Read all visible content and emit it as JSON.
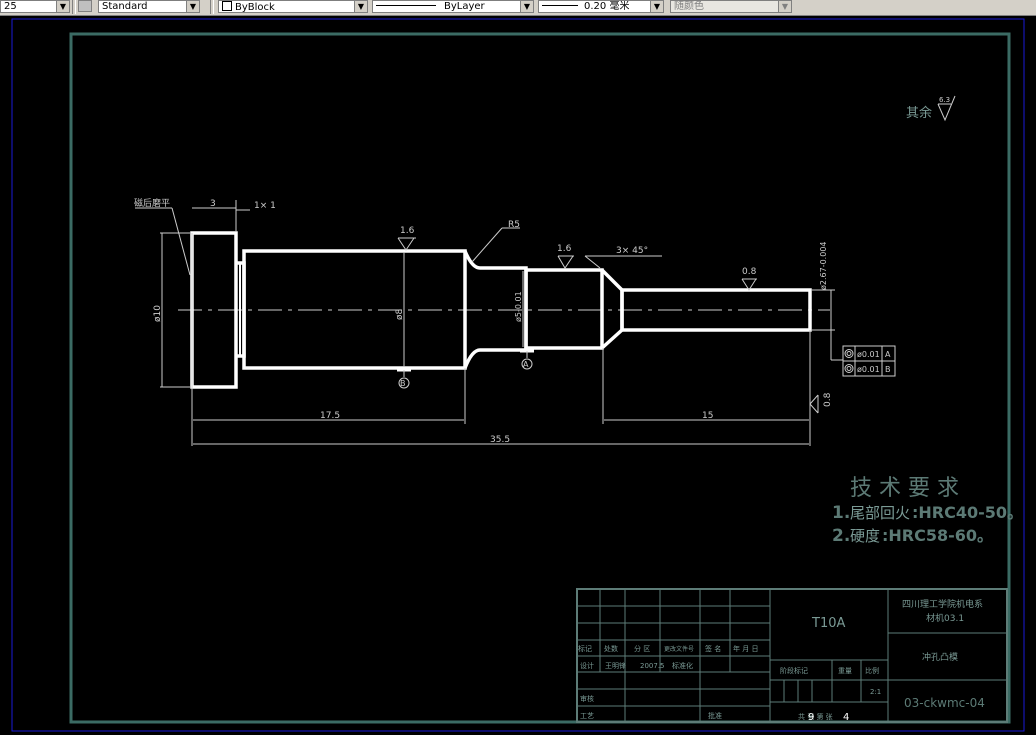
{
  "toolbar": {
    "scale_value": "25",
    "text_style": "Standard",
    "block": "ByBlock",
    "linetype": "ByLayer",
    "lineweight": "0.20 毫米",
    "color": "随颜色"
  },
  "drawing": {
    "roughness_other": "其余",
    "roughness_other_value": "6.3",
    "note_grind": "磁后磨平",
    "dim_3": "3",
    "dim_1x1": "1× 1",
    "dim_dia10": "ø10",
    "dim_dia8": "ø8",
    "dim_dia5": "ø5-0.01",
    "dim_dia267": "ø2.67-0.004",
    "dim_r5": "R5",
    "dim_chamfer": "3× 45°",
    "rough_1": "1.6",
    "rough_2": "1.6",
    "rough_3": "0.8",
    "rough_4": "0.8",
    "dim_175": "17.5",
    "dim_15": "15",
    "dim_355": "35.5",
    "datum_a": "A",
    "datum_b": "B",
    "tol_1": "ø0.01",
    "tol_1_datum": "A",
    "tol_2": "ø0.01",
    "tol_2_datum": "B"
  },
  "requirements": {
    "title": "技 术 要 求",
    "line1_num": "1.",
    "line1_text": "尾部回火",
    "line1_val": ":HRC40-50。",
    "line2_num": "2.",
    "line2_text": "硬度",
    "line2_val": ":HRC58-60。"
  },
  "title_block": {
    "material": "T10A",
    "school": "四川理工学院机电系",
    "class": "材机03.1",
    "part_name": "冲孔凸模",
    "drawing_no": "03-ckwmc-04",
    "scale": "2:1",
    "sheet_total": "9",
    "sheet_current": "4",
    "designer": "王明锋",
    "date": "2007.5",
    "label_mark": "标记",
    "label_count": "处数",
    "label_zone": "分 区",
    "label_change": "更改文件号",
    "label_sign": "签 名",
    "label_ymd": "年 月 日",
    "label_design": "设计",
    "label_std": "标准化",
    "label_review": "审核",
    "label_process": "工艺",
    "label_approve": "批准",
    "label_stage": "阶段标记",
    "label_weight": "重量",
    "label_ratio": "比例",
    "label_sheets": "共 张 第 张"
  }
}
